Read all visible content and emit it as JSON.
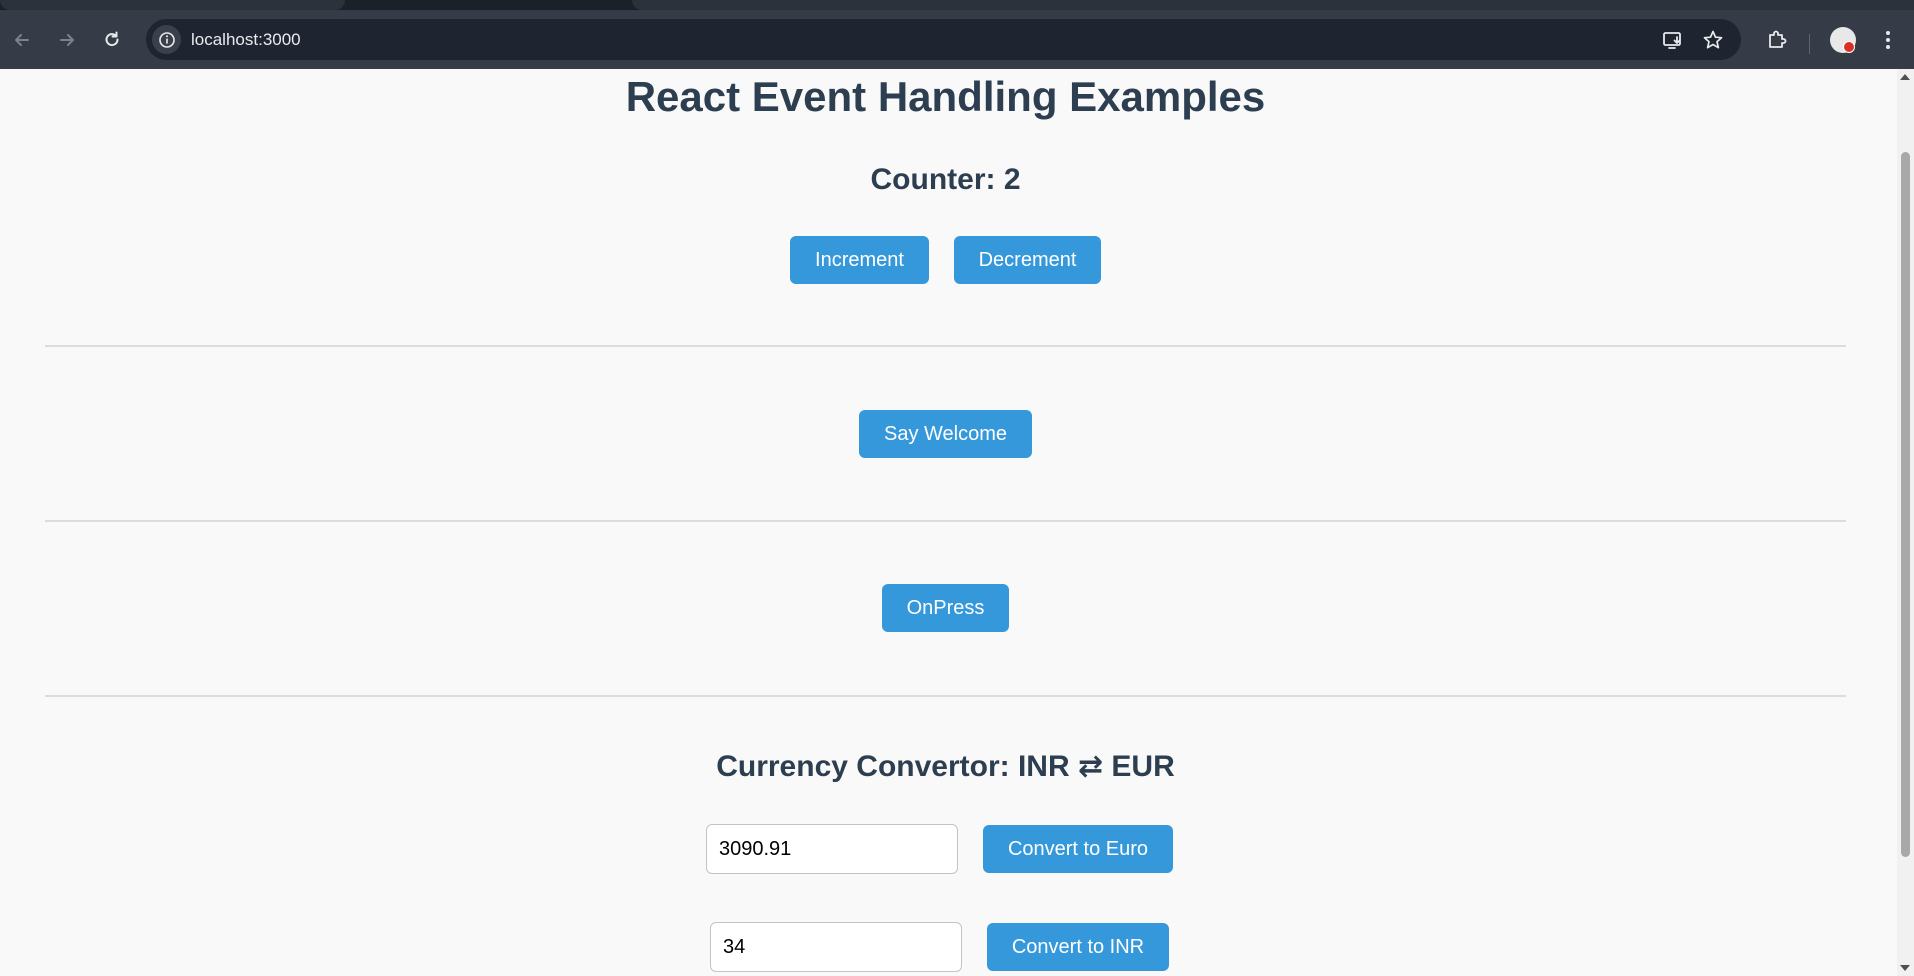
{
  "browser": {
    "url": "localhost:3000"
  },
  "page": {
    "title": "React Event Handling Examples",
    "counter": {
      "heading": "Counter: 2",
      "increment_label": "Increment",
      "decrement_label": "Decrement"
    },
    "welcome": {
      "button_label": "Say Welcome"
    },
    "onpress": {
      "button_label": "OnPress"
    },
    "currency": {
      "heading": "Currency Convertor: INR ⇄ EUR",
      "inr_value": "3090.91",
      "to_euro_label": "Convert to Euro",
      "eur_value": "34",
      "to_inr_label": "Convert to INR"
    }
  },
  "colors": {
    "accent": "#3498db",
    "heading": "#2c3e50",
    "background": "#f9f9f9"
  }
}
